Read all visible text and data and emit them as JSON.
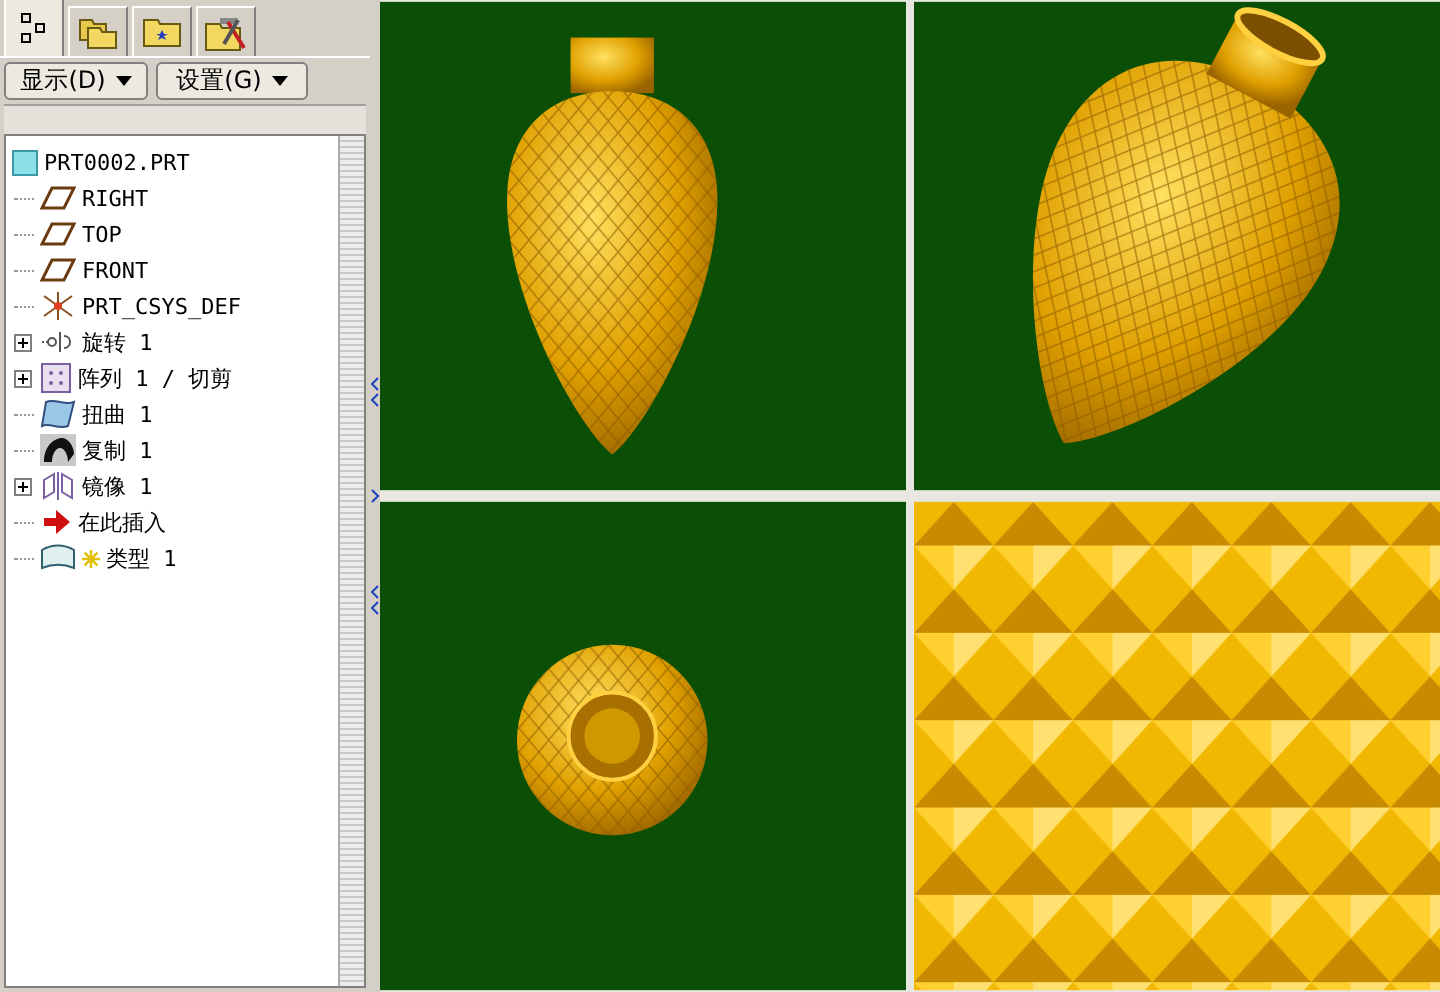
{
  "tabs": [
    {
      "kind": "tree",
      "selected": true
    },
    {
      "kind": "folders",
      "selected": false
    },
    {
      "kind": "star-folder",
      "selected": false
    },
    {
      "kind": "tools-folder",
      "selected": false
    }
  ],
  "toolbar_buttons": [
    {
      "label": "显示(D)"
    },
    {
      "label": "设置(G)"
    }
  ],
  "tree": {
    "label": "PRT0002.PRT",
    "kind": "part",
    "children": [
      {
        "label": "RIGHT",
        "kind": "plane",
        "has_children": false
      },
      {
        "label": "TOP",
        "kind": "plane",
        "has_children": false
      },
      {
        "label": "FRONT",
        "kind": "plane",
        "has_children": false
      },
      {
        "label": "PRT_CSYS_DEF",
        "kind": "csys",
        "has_children": false
      },
      {
        "label": "旋转 1",
        "kind": "revolve",
        "has_children": true
      },
      {
        "label": "阵列 1 / 切剪",
        "kind": "pattern",
        "has_children": true
      },
      {
        "label": "扭曲 1",
        "kind": "warp",
        "has_children": false
      },
      {
        "label": "复制 1",
        "kind": "copy",
        "has_children": false
      },
      {
        "label": "镜像 1",
        "kind": "mirror",
        "has_children": true
      },
      {
        "label": "在此插入",
        "kind": "insert",
        "has_children": false
      },
      {
        "label": "类型 1",
        "kind": "style",
        "has_children": false
      }
    ]
  }
}
